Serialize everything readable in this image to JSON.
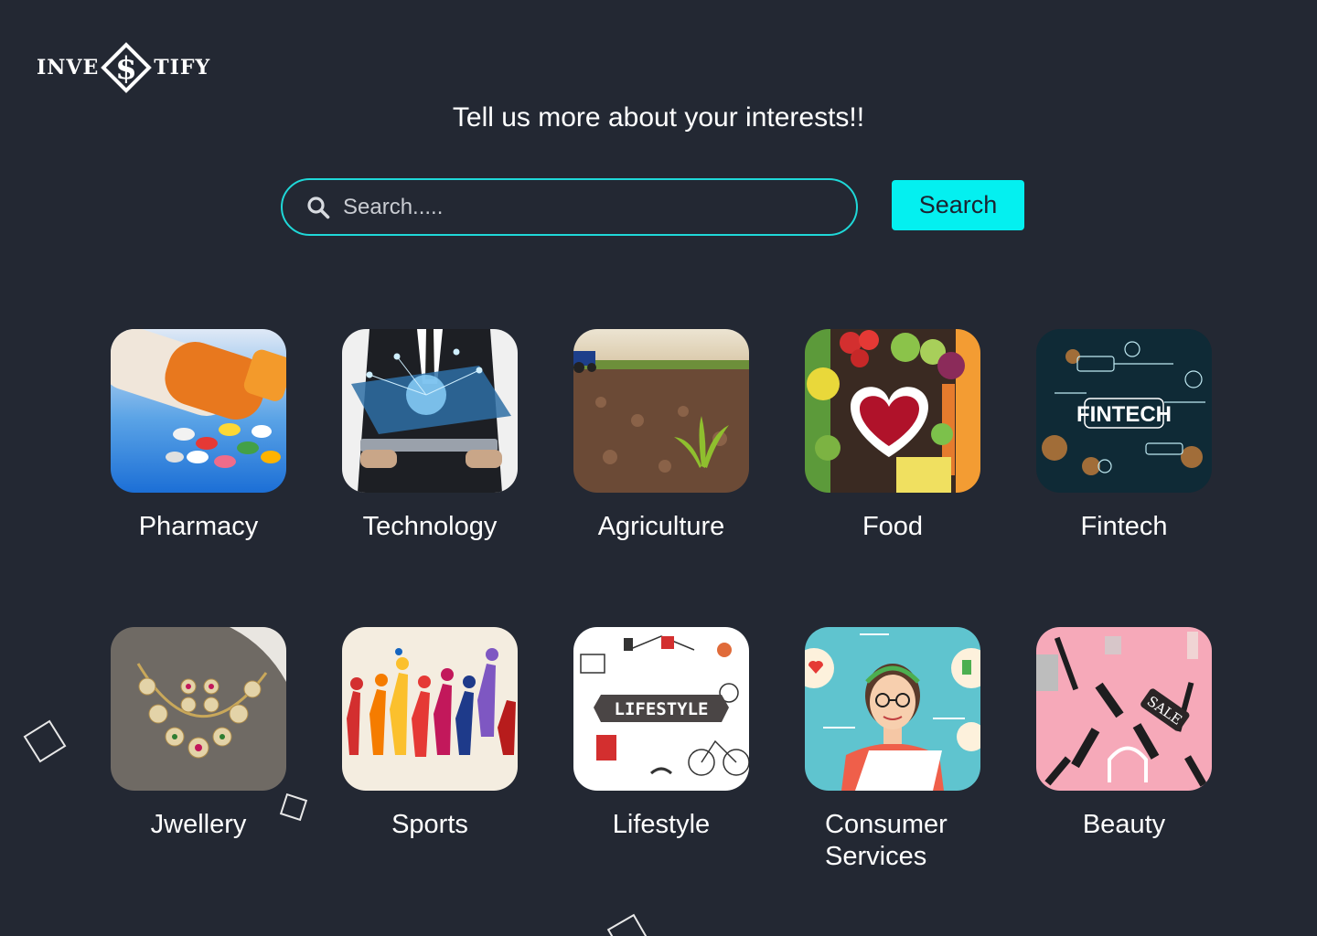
{
  "logo": {
    "left_text": "INVE",
    "right_text": "TIFY",
    "mark_glyph": "$"
  },
  "heading": "Tell us more about your interests!!",
  "search": {
    "placeholder": "Search.....",
    "value": "",
    "button_label": "Search"
  },
  "colors": {
    "background": "#232833",
    "accent": "#04f0f0",
    "search_border": "#1fd8d8"
  },
  "categories": [
    {
      "label": "Pharmacy",
      "image": "pills-photo"
    },
    {
      "label": "Technology",
      "image": "tablet-network-photo"
    },
    {
      "label": "Agriculture",
      "image": "field-sprout-photo"
    },
    {
      "label": "Food",
      "image": "vegetables-photo"
    },
    {
      "label": "Fintech",
      "image": "fintech-network-photo",
      "image_text": "FINTECH"
    },
    {
      "label": "Jwellery",
      "image": "necklace-photo"
    },
    {
      "label": "Sports",
      "image": "athletes-silhouettes"
    },
    {
      "label": "Lifestyle",
      "image": "lifestyle-doodles",
      "image_text": "LIFESTYLE"
    },
    {
      "label": "Consumer Services",
      "image": "support-agent-illustration"
    },
    {
      "label": "Beauty",
      "image": "cosmetics-photo",
      "image_text": "SALE"
    }
  ]
}
